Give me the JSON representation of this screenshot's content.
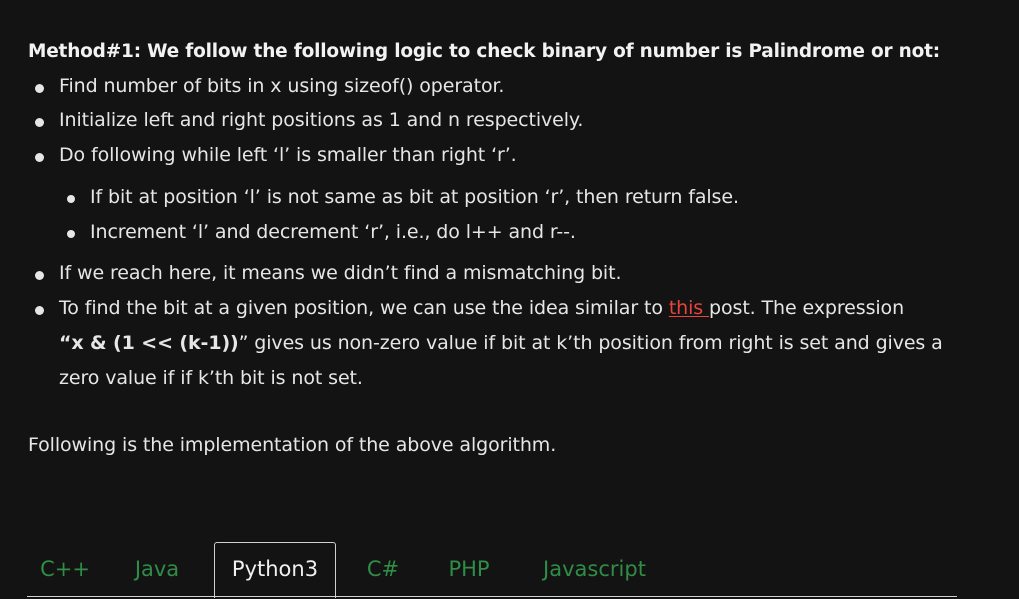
{
  "heading": "Method#1:  We follow the following logic to check binary of number is Palindrome or not:",
  "bullets": [
    " Find number of bits in x using sizeof() operator.",
    "Initialize left and right positions as 1 and n respectively.",
    "Do following while left ‘l’ is smaller than right ‘r’."
  ],
  "sub_bullets": [
    "If bit at position ‘l’ is not same as bit at position ‘r’, then return false.",
    "Increment ‘l’ and decrement ‘r’, i.e., do l++ and r--."
  ],
  "bullet4": " If we reach here, it means we didn’t find a mismatching bit.",
  "bullet5": {
    "before_link": "To find the bit at a given position, we can use the idea similar to ",
    "link": "this ",
    "after_link": "post. The expression",
    "line2_bold": "“x & (1 << (k-1))",
    "line2_rest": "” gives us non-zero value if bit at k’th position from right is set and gives a",
    "line3": "zero value if if k’th bit is not set."
  },
  "following_text": "Following is the implementation of the above algorithm.",
  "tabs": [
    "C++",
    "Java",
    "Python3",
    "C#",
    "PHP",
    "Javascript"
  ],
  "active_tab": "Python3",
  "colors": {
    "background": "#131313",
    "text": "#e6e6e6",
    "link": "#e8453c",
    "tab_inactive": "#2f8d46"
  }
}
